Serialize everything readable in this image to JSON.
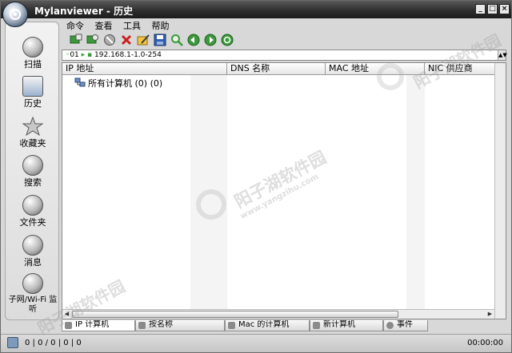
{
  "window": {
    "title": "Mylanviewer - 历史",
    "controls": {
      "minimize": "_",
      "maximize": "□",
      "close": "×"
    }
  },
  "sidebar": {
    "items": [
      {
        "label": "扫描",
        "icon": "scan-icon"
      },
      {
        "label": "历史",
        "icon": "history-icon"
      },
      {
        "label": "收藏夹",
        "icon": "favorites-star-icon"
      },
      {
        "label": "搜索",
        "icon": "search-icon"
      },
      {
        "label": "文件夹",
        "icon": "folder-icon"
      },
      {
        "label": "消息",
        "icon": "message-icon"
      },
      {
        "label": "子网/Wi-Fi 监听",
        "icon": "subnet-wifi-icon"
      }
    ]
  },
  "menu": {
    "items": [
      "命令",
      "查看",
      "工具",
      "帮助"
    ]
  },
  "toolbar": {
    "buttons": [
      "add-computer-icon",
      "refresh-list-icon",
      "disconnect-icon",
      "delete-icon",
      "edit-icon",
      "save-icon",
      "search-icon",
      "back-icon",
      "forward-icon",
      "refresh-icon"
    ]
  },
  "address": {
    "value": "192.168.1-1.0-254",
    "prefix": "01"
  },
  "list": {
    "columns": [
      "IP 地址",
      "DNS 名称",
      "MAC 地址",
      "NIC 供应商"
    ],
    "tree_root": "所有计算机 (0) (0)"
  },
  "tabs": [
    "IP 计算机",
    "按名称",
    "Mac 的计算机",
    "新计算机",
    "事件"
  ],
  "status": {
    "counts": "0 | 0 / 0 | 0 | 0",
    "timer": "00:00:00"
  },
  "watermark": {
    "text": "阳子湖软件园",
    "url": "www.yangzihu.com"
  },
  "colors": {
    "title_bar": "#2e2e2e",
    "accent_green": "#3c9a3c",
    "delete_red": "#cc1f1f"
  }
}
